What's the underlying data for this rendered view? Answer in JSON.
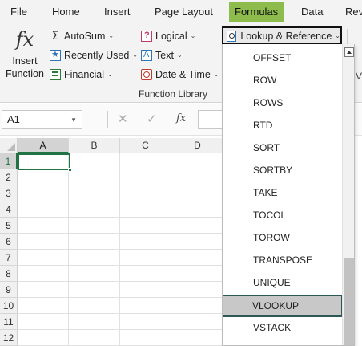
{
  "tabs": {
    "file": "File",
    "home": "Home",
    "insert": "Insert",
    "page_layout": "Page Layout",
    "formulas": "Formulas",
    "data": "Data",
    "review_partial": "Rev"
  },
  "ribbon": {
    "insert_function": {
      "icon_glyph": "fx",
      "line1": "Insert",
      "line2": "Function"
    },
    "autosum": "AutoSum",
    "recently_used": "Recently Used",
    "financial": "Financial",
    "logical": "Logical",
    "text": "Text",
    "date_time": "Date & Time",
    "lookup_reference": "Lookup & Reference",
    "group_label": "Function Library",
    "partial_right": "V",
    "chevron": "⌄"
  },
  "formula_bar": {
    "name_box": "A1",
    "cancel_glyph": "✕",
    "enter_glyph": "✓",
    "fx_glyph": "fx",
    "formula": ""
  },
  "grid": {
    "columns": [
      "A",
      "B",
      "C",
      "D"
    ],
    "rows": [
      "1",
      "2",
      "3",
      "4",
      "5",
      "6",
      "7",
      "8",
      "9",
      "10",
      "11",
      "12"
    ],
    "active_cell": "A1"
  },
  "dropdown": {
    "items": [
      "OFFSET",
      "ROW",
      "ROWS",
      "RTD",
      "SORT",
      "SORTBY",
      "TAKE",
      "TOCOL",
      "TOROW",
      "TRANSPOSE",
      "UNIQUE",
      "VLOOKUP",
      "VSTACK"
    ],
    "highlighted": "VLOOKUP"
  },
  "colors": {
    "formulas_tab": "#8dbb4c",
    "excel_green": "#217346",
    "highlight_border": "#2b5756",
    "highlight_fill": "#c8c8c8"
  }
}
